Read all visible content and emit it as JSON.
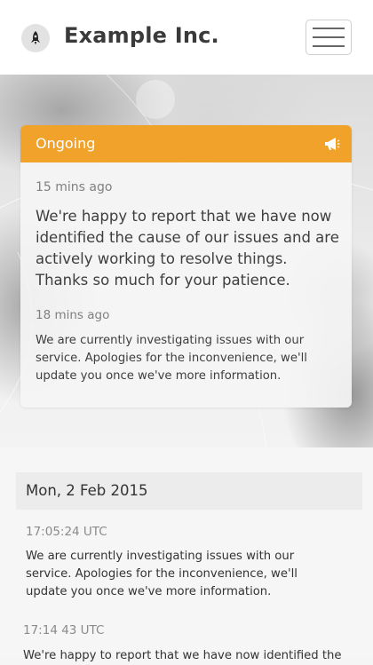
{
  "header": {
    "brand": "Example Inc.",
    "logo_icon": "rocket-icon",
    "menu_icon": "hamburger-icon"
  },
  "incident": {
    "status_label": "Ongoing",
    "status_icon": "megaphone-icon",
    "accent_color": "#f0a22a",
    "updates": [
      {
        "time": "15 mins ago",
        "text": "We're happy to report that we have now identified the cause of our issues and are actively working to resolve things. Thanks so much for your patience."
      },
      {
        "time": "18 mins ago",
        "text": "We are currently investigating issues with our service. Apologies for the inconvenience, we'll update you once we've more information."
      }
    ]
  },
  "history": {
    "date": "Mon, 2 Feb 2015",
    "entries": [
      {
        "time": "17:05:24 UTC",
        "text": "We are currently investigating issues with our service. Apologies for the inconvenience, we'll update you once we've more information."
      },
      {
        "time": "17:14 43 UTC",
        "text": "We're happy to report that we have now identified the"
      }
    ]
  }
}
